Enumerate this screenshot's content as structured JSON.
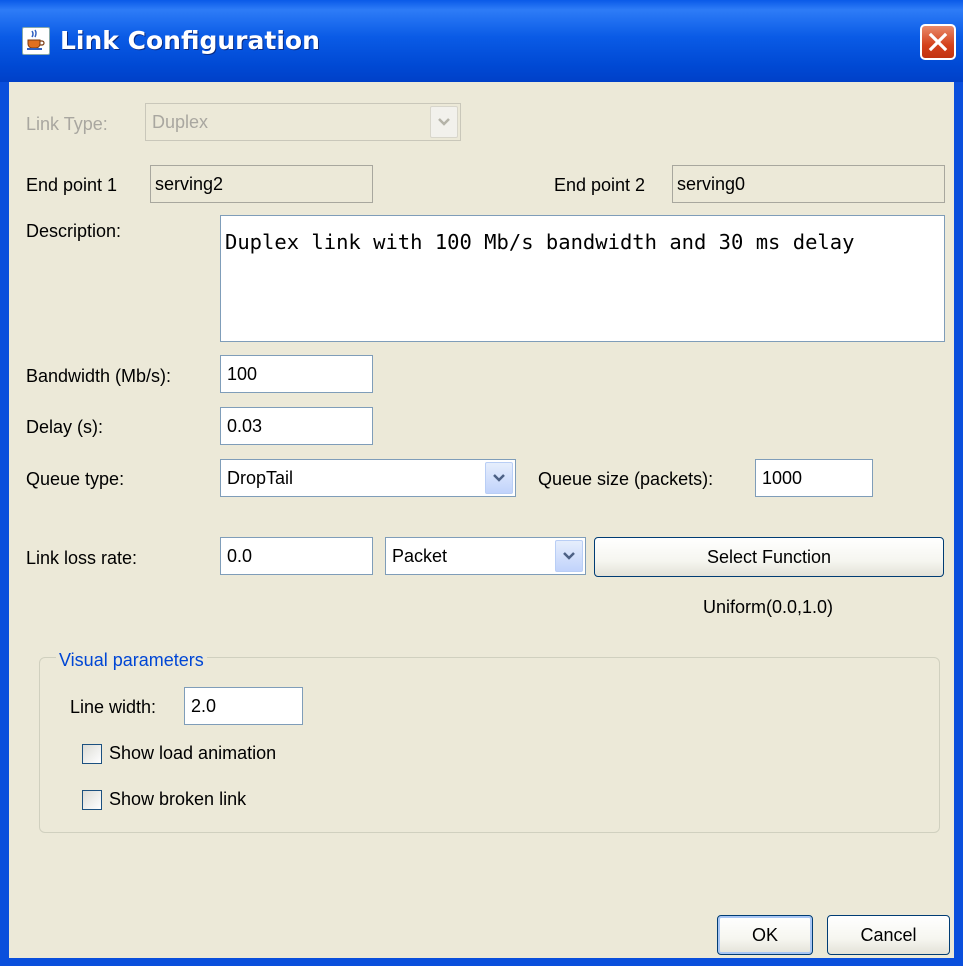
{
  "window": {
    "title": "Link Configuration"
  },
  "link_type": {
    "label": "Link Type:",
    "value": "Duplex"
  },
  "endpoints": {
    "ep1_label": "End point 1",
    "ep1_value": "serving2",
    "ep2_label": "End point 2",
    "ep2_value": "serving0"
  },
  "description": {
    "label": "Description:",
    "value": "Duplex link with 100 Mb/s bandwidth and 30 ms delay"
  },
  "bandwidth": {
    "label": "Bandwidth (Mb/s):",
    "value": "100"
  },
  "delay": {
    "label": "Delay (s):",
    "value": "0.03"
  },
  "queue": {
    "type_label": "Queue type:",
    "type_value": "DropTail",
    "size_label": "Queue size (packets):",
    "size_value": "1000"
  },
  "loss": {
    "label": "Link loss rate:",
    "value": "0.0",
    "unit_value": "Packet",
    "select_button": "Select Function",
    "function": "Uniform(0.0,1.0)"
  },
  "visual": {
    "group_title": "Visual parameters",
    "line_width_label": "Line width:",
    "line_width_value": "2.0",
    "show_load_animation": {
      "label": "Show load animation",
      "checked": false
    },
    "show_broken_link": {
      "label": "Show broken link",
      "checked": false
    }
  },
  "buttons": {
    "ok": "OK",
    "cancel": "Cancel"
  },
  "colors": {
    "titlebar": "#0a5be6",
    "client_bg": "#ece9d8",
    "group_title": "#0046d5",
    "close_red": "#d4411b"
  },
  "icons": {
    "app": "java-cup-icon",
    "close": "close-icon",
    "dropdown": "chevron-down-icon"
  }
}
